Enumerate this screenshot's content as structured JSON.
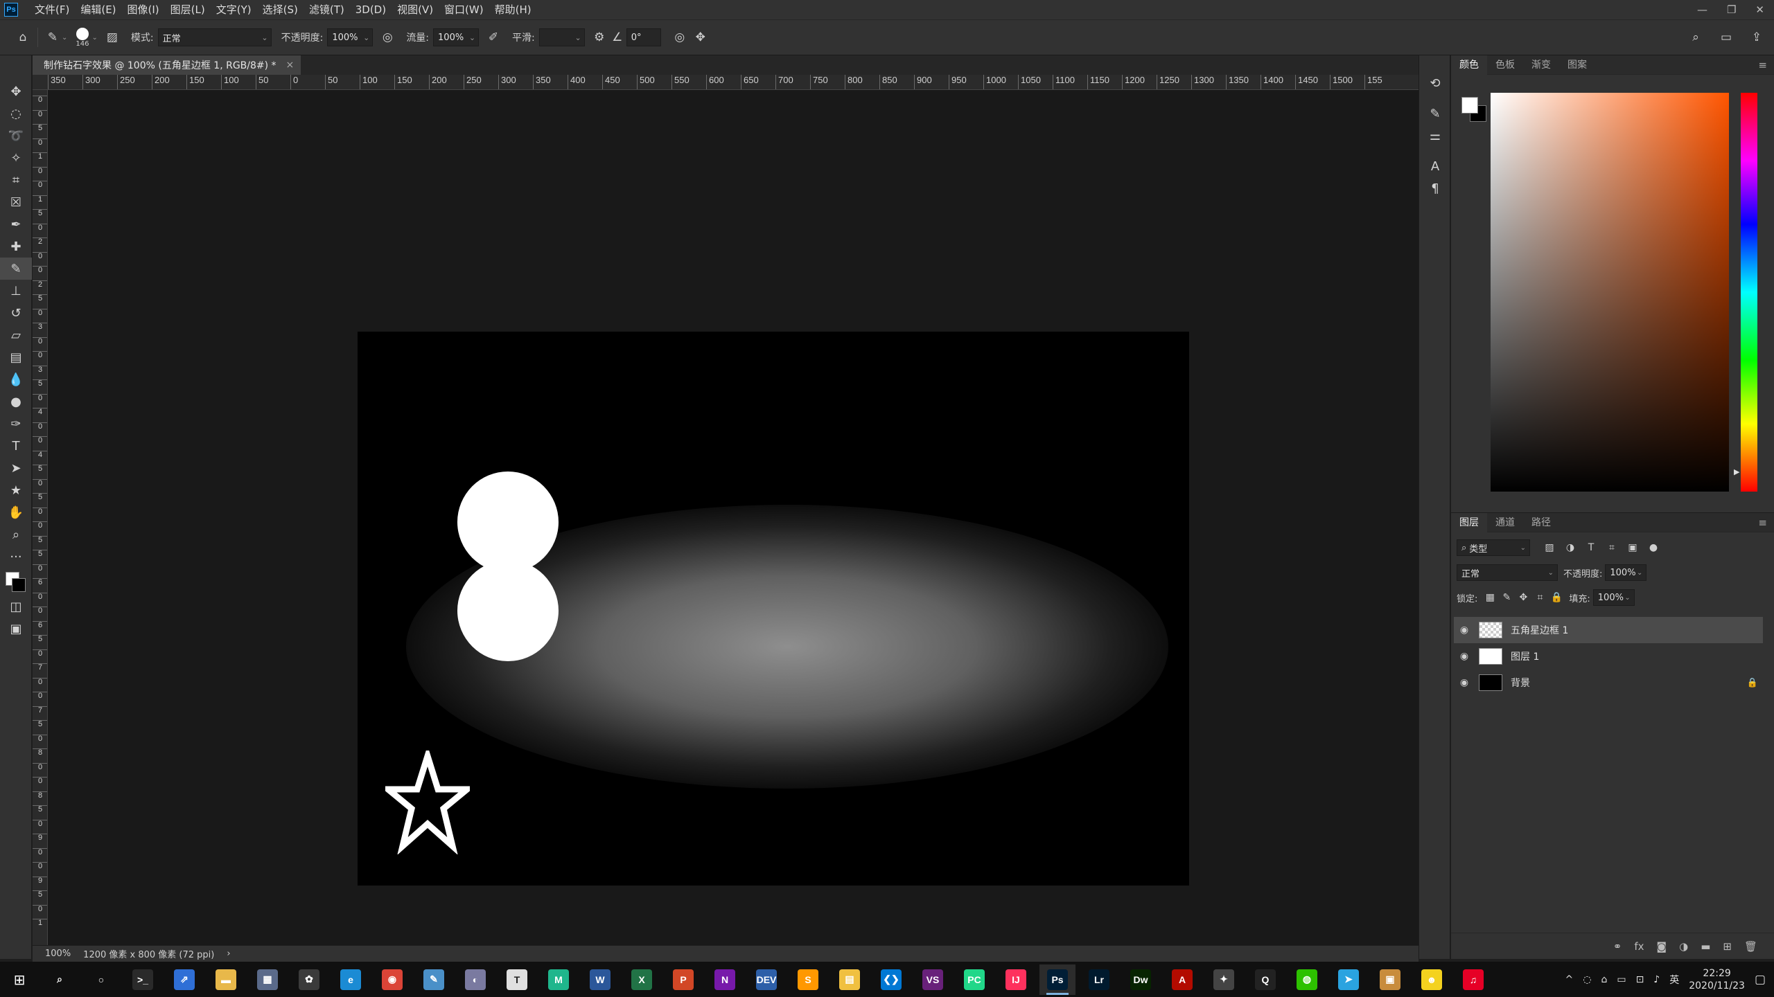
{
  "app": {
    "logo": "Ps"
  },
  "menubar": {
    "items": [
      "文件(F)",
      "编辑(E)",
      "图像(I)",
      "图层(L)",
      "文字(Y)",
      "选择(S)",
      "滤镜(T)",
      "3D(D)",
      "视图(V)",
      "窗口(W)",
      "帮助(H)"
    ],
    "window_controls": [
      "—",
      "❐",
      "✕"
    ]
  },
  "options": {
    "brush_size": "146",
    "mode_label": "模式:",
    "mode_value": "正常",
    "opacity_label": "不透明度:",
    "opacity_value": "100%",
    "flow_label": "流量:",
    "flow_value": "100%",
    "smoothing_label": "平滑:",
    "smoothing_value": "",
    "angle_value": "0°"
  },
  "document": {
    "tab_title": "制作钻石字效果 @ 100% (五角星边框 1, RGB/8#) *",
    "close": "×"
  },
  "ruler_h": [
    "350",
    "300",
    "250",
    "200",
    "150",
    "100",
    "50",
    "0",
    "50",
    "100",
    "150",
    "200",
    "250",
    "300",
    "350",
    "400",
    "450",
    "500",
    "550",
    "600",
    "650",
    "700",
    "750",
    "800",
    "850",
    "900",
    "950",
    "1000",
    "1050",
    "1100",
    "1150",
    "1200",
    "1250",
    "1300",
    "1350",
    "1400",
    "1450",
    "1500",
    "155"
  ],
  "ruler_v": [
    "0",
    "0",
    "5",
    "0",
    "1",
    "0",
    "0",
    "1",
    "5",
    "0",
    "2",
    "0",
    "0",
    "2",
    "5",
    "0",
    "3",
    "0",
    "0",
    "3",
    "5",
    "0",
    "4",
    "0",
    "0",
    "4",
    "5",
    "0",
    "5",
    "0",
    "0",
    "5",
    "5",
    "0",
    "6",
    "0",
    "0",
    "6",
    "5",
    "0",
    "7",
    "0",
    "0",
    "7",
    "5",
    "0",
    "8",
    "0",
    "0",
    "8",
    "5",
    "0",
    "9",
    "0",
    "0",
    "9",
    "5",
    "0",
    "1"
  ],
  "status": {
    "zoom": "100%",
    "doc_info": "1200 像素 x 800 像素 (72 ppi)",
    "arrow": "›"
  },
  "color_panel": {
    "tabs": [
      "颜色",
      "色板",
      "渐变",
      "图案"
    ],
    "active_tab": 0,
    "fg_color": "#ffffff",
    "bg_color": "#000000",
    "hue_color": "#ff5500"
  },
  "layers_panel": {
    "tabs": [
      "图层",
      "通道",
      "路径"
    ],
    "active_tab": 0,
    "filter_label": "类型",
    "blend_mode": "正常",
    "opacity_label": "不透明度:",
    "opacity_value": "100%",
    "lock_label": "锁定:",
    "fill_label": "填充:",
    "fill_value": "100%",
    "layers": [
      {
        "name": "五角星边框 1",
        "selected": true,
        "thumb": "transparent",
        "locked": false
      },
      {
        "name": "图层 1",
        "selected": false,
        "thumb": "white",
        "locked": false
      },
      {
        "name": "背景",
        "selected": false,
        "thumb": "black",
        "locked": true
      }
    ],
    "footer_icons": [
      "link-icon",
      "fx-icon",
      "mask-icon",
      "adjustment-icon",
      "group-icon",
      "new-layer-icon",
      "trash-icon"
    ]
  },
  "taskbar": {
    "apps": [
      {
        "name": "search",
        "label": "⌕",
        "color": "#101010"
      },
      {
        "name": "cortana",
        "label": "○",
        "color": "#101010"
      },
      {
        "name": "terminal",
        "label": ">_",
        "color": "#2a2a2a"
      },
      {
        "name": "app-blue",
        "label": "⇗",
        "color": "#2f6fd6"
      },
      {
        "name": "file-explorer",
        "label": "▬",
        "color": "#e8b84a"
      },
      {
        "name": "calculator",
        "label": "▦",
        "color": "#5a6a8a"
      },
      {
        "name": "settings",
        "label": "✿",
        "color": "#3b3b3b"
      },
      {
        "name": "edge",
        "label": "e",
        "color": "#1b8bd4"
      },
      {
        "name": "chrome",
        "label": "◉",
        "color": "#db4437"
      },
      {
        "name": "notes",
        "label": "✎",
        "color": "#4a90c8"
      },
      {
        "name": "paint",
        "label": "◐",
        "color": "#7a7aa0"
      },
      {
        "name": "typora",
        "label": "T",
        "color": "#e0e0e0"
      },
      {
        "name": "webstorm",
        "label": "M",
        "color": "#1fb68c"
      },
      {
        "name": "word",
        "label": "W",
        "color": "#2b579a"
      },
      {
        "name": "excel",
        "label": "X",
        "color": "#217346"
      },
      {
        "name": "powerpoint",
        "label": "P",
        "color": "#d24726"
      },
      {
        "name": "onenote",
        "label": "N",
        "color": "#7719aa"
      },
      {
        "name": "dev-cpp",
        "label": "DEV",
        "color": "#2d5fa8"
      },
      {
        "name": "sublime",
        "label": "S",
        "color": "#ff9800"
      },
      {
        "name": "notepad",
        "label": "▤",
        "color": "#f0c040"
      },
      {
        "name": "vscode",
        "label": "❮❯",
        "color": "#0078d4"
      },
      {
        "name": "visual-studio",
        "label": "VS",
        "color": "#68217a"
      },
      {
        "name": "pycharm",
        "label": "PC",
        "color": "#21d789"
      },
      {
        "name": "intellij",
        "label": "IJ",
        "color": "#fe315d"
      },
      {
        "name": "photoshop",
        "label": "Ps",
        "color": "#001e36",
        "active": true
      },
      {
        "name": "lightroom",
        "label": "Lr",
        "color": "#001a2e"
      },
      {
        "name": "dreamweaver",
        "label": "Dw",
        "color": "#072401"
      },
      {
        "name": "acrobat",
        "label": "A",
        "color": "#b30b00"
      },
      {
        "name": "app-ring",
        "label": "✦",
        "color": "#444444"
      },
      {
        "name": "qq",
        "label": "Q",
        "color": "#222222"
      },
      {
        "name": "wechat",
        "label": "◍",
        "color": "#2dc100"
      },
      {
        "name": "telegram",
        "label": "➤",
        "color": "#2aa3e0"
      },
      {
        "name": "store",
        "label": "▣",
        "color": "#c88c3c"
      },
      {
        "name": "app-yellow",
        "label": "☻",
        "color": "#f4d21f"
      },
      {
        "name": "netease-music",
        "label": "♫",
        "color": "#e60026"
      }
    ],
    "tray_icons": [
      "^",
      "◌",
      "⌂",
      "▭",
      "⊡",
      "♪"
    ],
    "ime": "英",
    "time": "22:29",
    "date": "2020/11/23",
    "notification": "▢"
  }
}
